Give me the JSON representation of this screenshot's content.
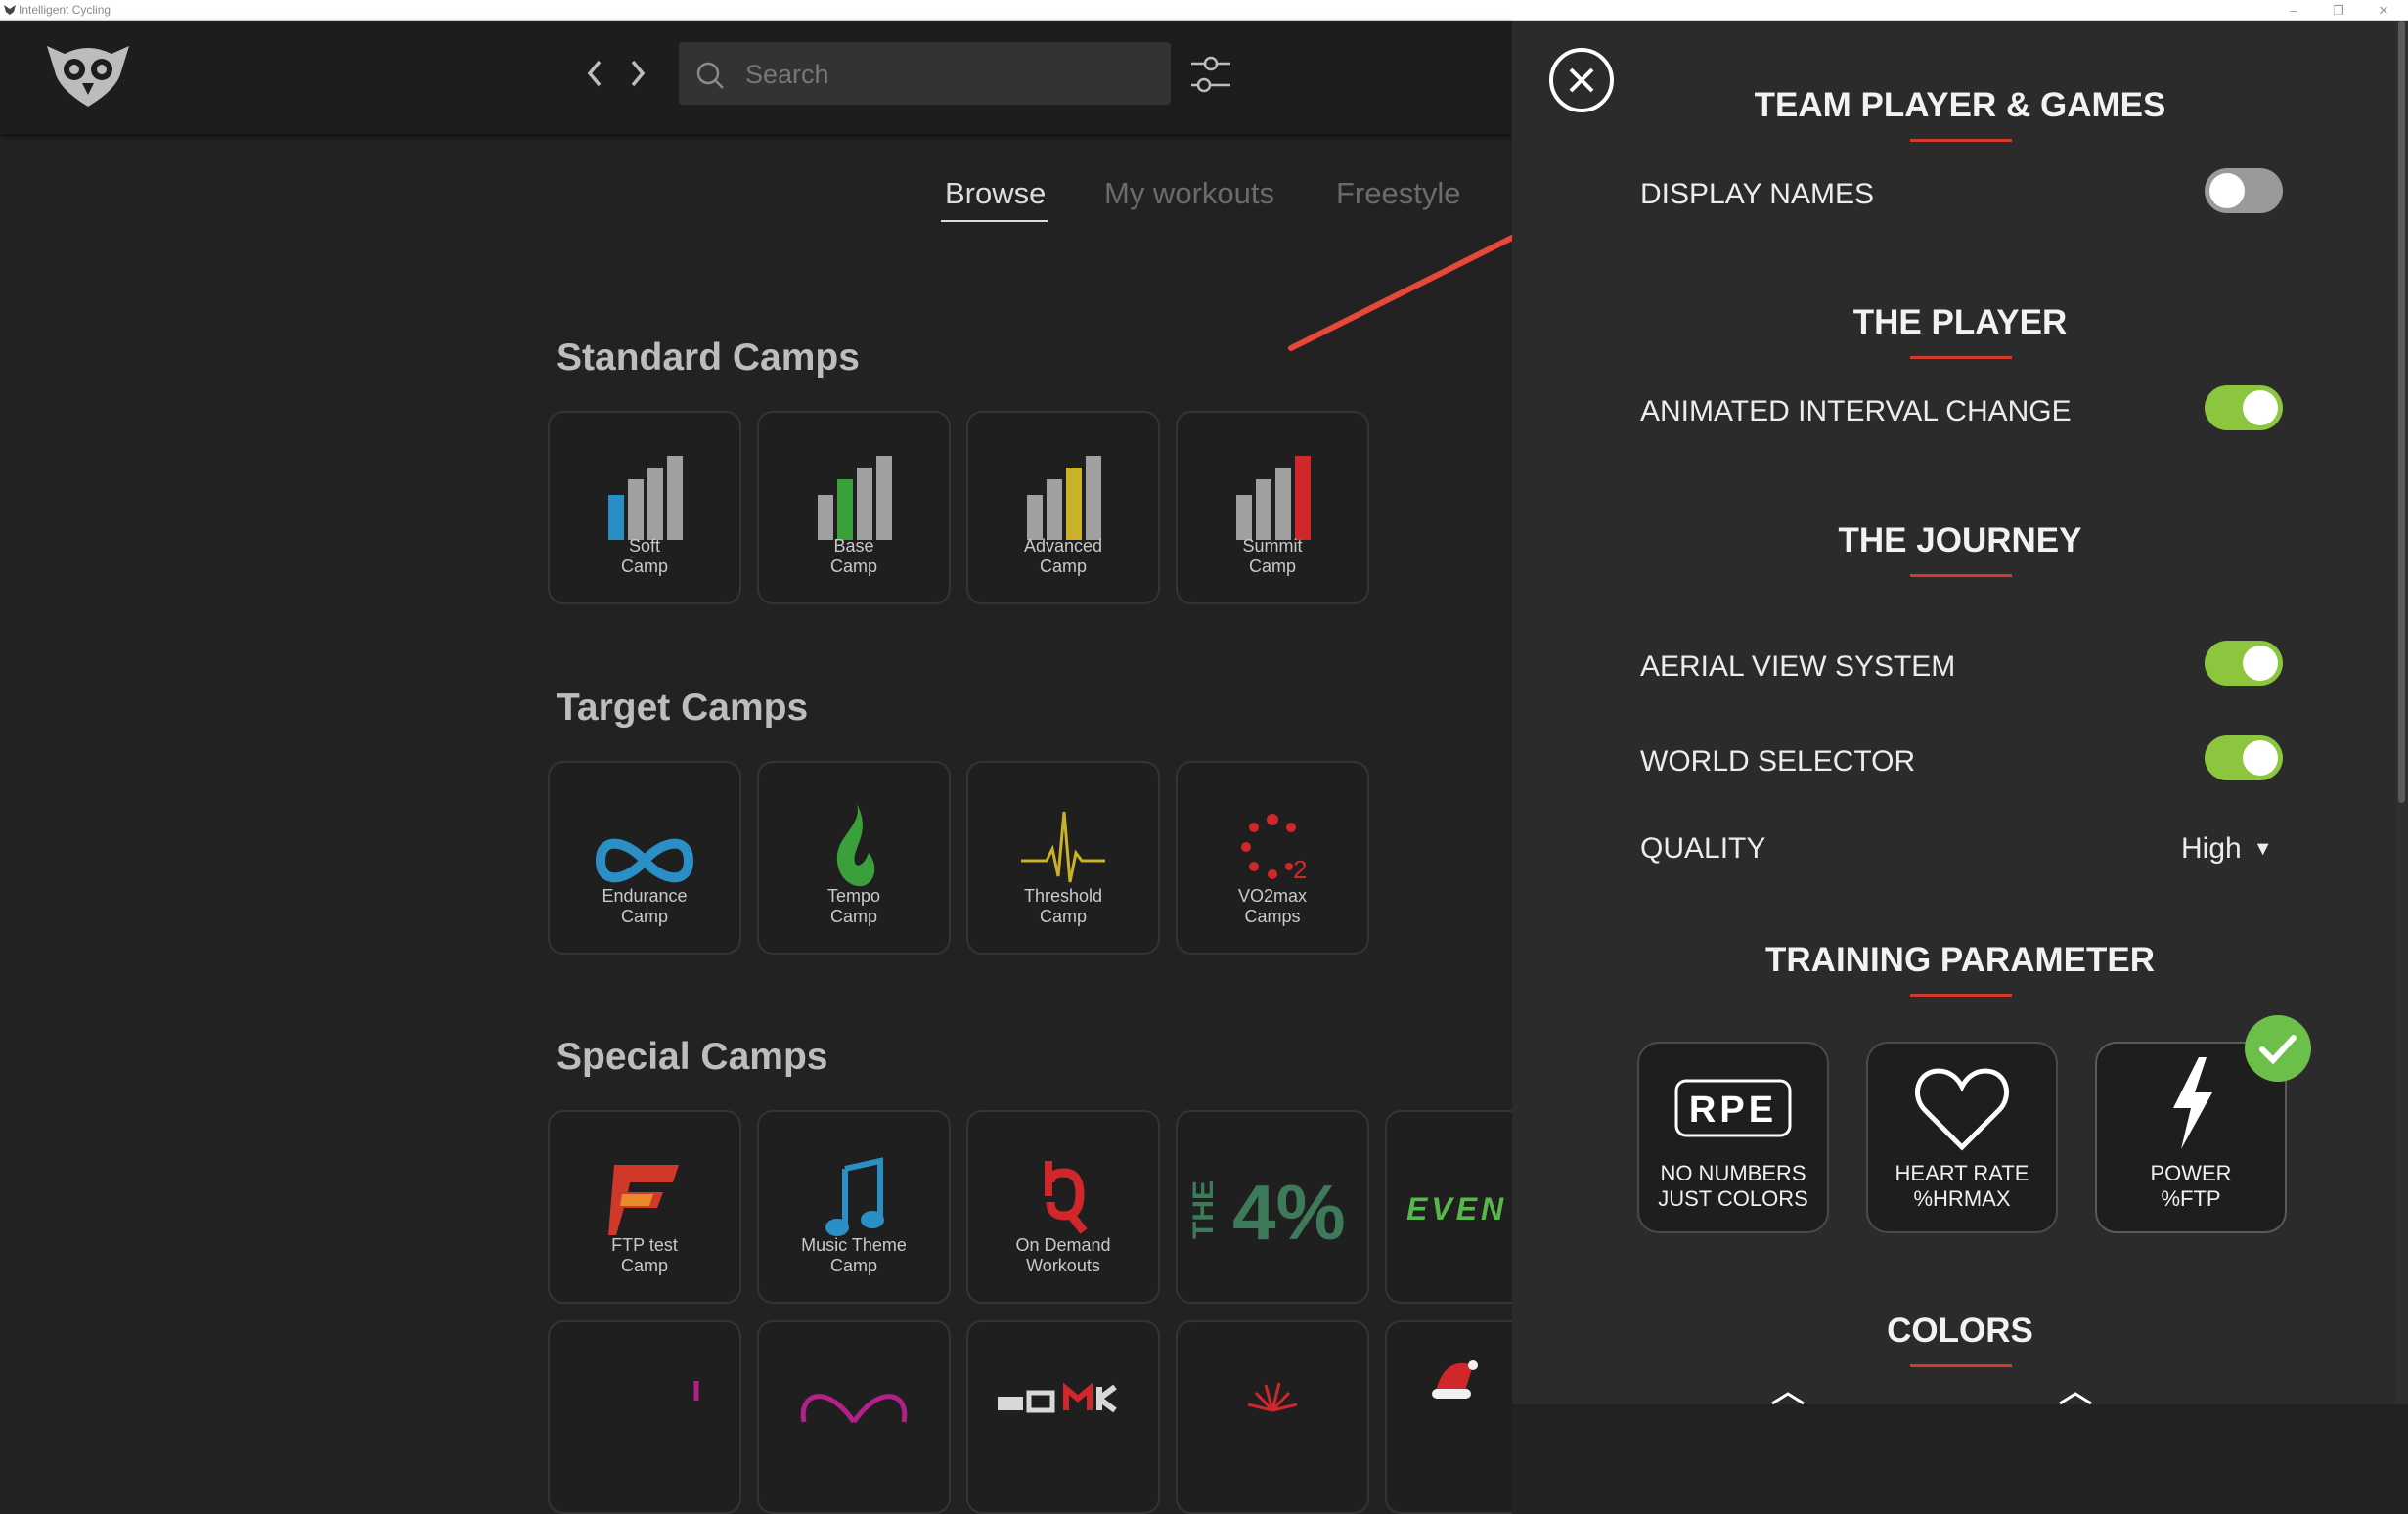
{
  "window": {
    "title": "Intelligent Cycling",
    "minimize": "–",
    "restore": "❐",
    "close": "✕"
  },
  "header": {
    "search_placeholder": "Search"
  },
  "tabs": [
    {
      "label": "Browse",
      "active": true
    },
    {
      "label": "My workouts",
      "active": false
    },
    {
      "label": "Freestyle",
      "active": false
    }
  ],
  "sections": {
    "standard": {
      "title": "Standard Camps",
      "items": [
        {
          "label": "Soft\nCamp",
          "icon": "bars-blue-icon"
        },
        {
          "label": "Base\nCamp",
          "icon": "bars-green-icon"
        },
        {
          "label": "Advanced\nCamp",
          "icon": "bars-yellow-icon"
        },
        {
          "label": "Summit\nCamp",
          "icon": "bars-red-icon"
        }
      ]
    },
    "target": {
      "title": "Target Camps",
      "items": [
        {
          "label": "Endurance\nCamp",
          "icon": "infinity-icon"
        },
        {
          "label": "Tempo\nCamp",
          "icon": "flame-icon"
        },
        {
          "label": "Threshold\nCamp",
          "icon": "heartbeat-icon"
        },
        {
          "label": "VO2max\nCamps",
          "icon": "dots-circle-icon"
        }
      ]
    },
    "special": {
      "title": "Special Camps",
      "items": [
        {
          "label": "FTP test\nCamp",
          "icon": "ftp-logo-icon"
        },
        {
          "label": "Music Theme\nCamp",
          "icon": "music-note-icon"
        },
        {
          "label": "On Demand\nWorkouts",
          "icon": "on-demand-logo-icon"
        },
        {
          "label": "",
          "icon": "the-4-percent-logo",
          "logo_text": "THE4%"
        },
        {
          "label": "",
          "icon": "even-logo",
          "logo_text": "EVEN"
        }
      ]
    }
  },
  "settings": {
    "team_heading": "TEAM PLAYER & GAMES",
    "display_names": {
      "label": "DISPLAY NAMES",
      "on": false
    },
    "player_heading": "THE PLAYER",
    "animated_interval": {
      "label": "ANIMATED INTERVAL CHANGE",
      "on": true
    },
    "journey_heading": "THE JOURNEY",
    "aerial_view": {
      "label": "AERIAL VIEW SYSTEM",
      "on": true
    },
    "world_selector": {
      "label": "WORLD SELECTOR",
      "on": true
    },
    "quality": {
      "label": "QUALITY",
      "value": "High"
    },
    "training_heading": "TRAINING PARAMETER",
    "params": [
      {
        "text": "NO NUMBERS\nJUST COLORS",
        "icon_text": "RPE",
        "selected": false
      },
      {
        "text": "HEART RATE\n%HRMAX",
        "selected": false
      },
      {
        "text": "POWER\n%FTP",
        "selected": true
      }
    ],
    "colors_heading": "COLORS"
  },
  "colors": {
    "accent_red": "#d23a2c",
    "toggle_on": "#8cc63f",
    "toggle_off": "#9a9a9a",
    "check_green": "#6cc04a"
  }
}
